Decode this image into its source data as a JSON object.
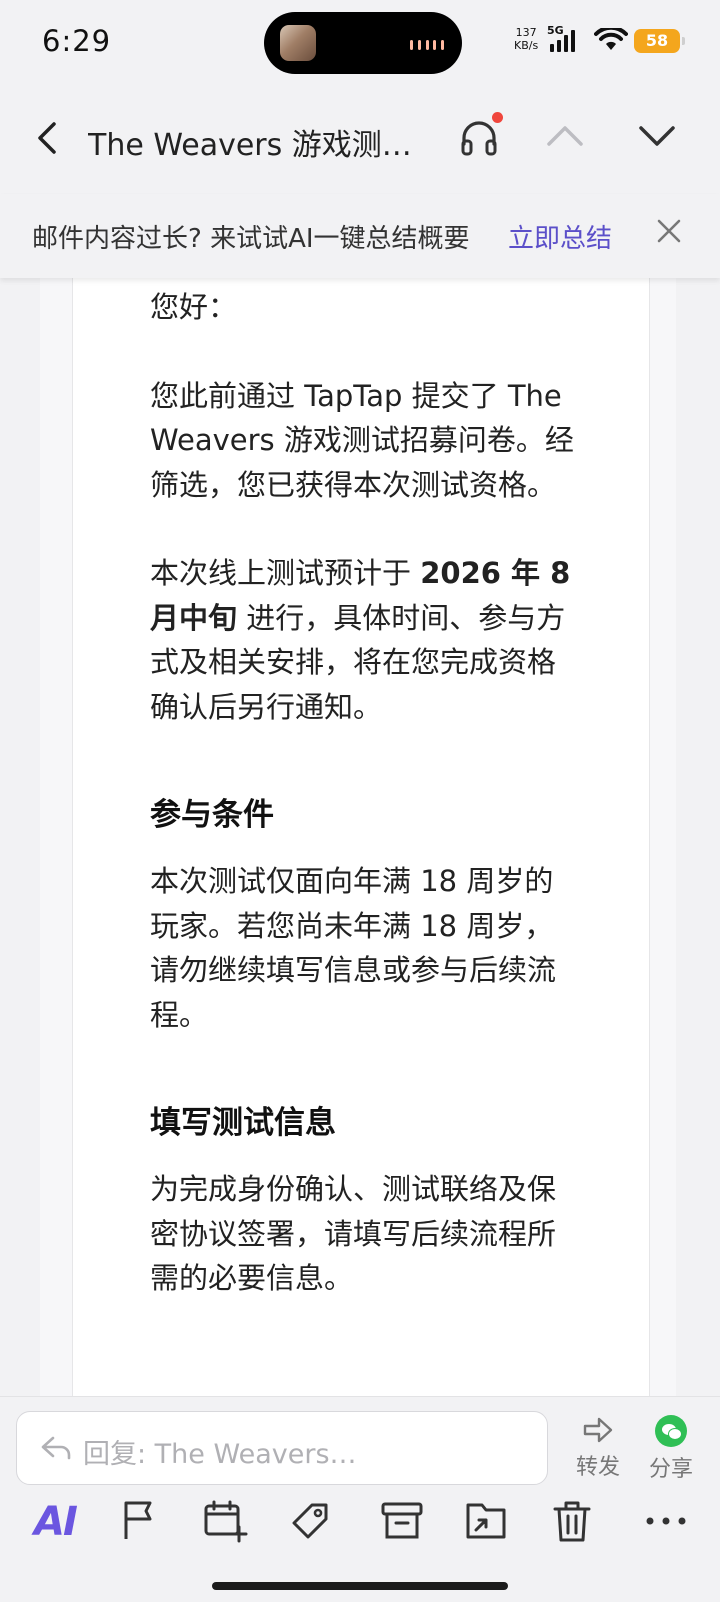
{
  "status_bar": {
    "time": "6:29",
    "net_speed_value": "137",
    "net_speed_unit": "KB/s",
    "network_type": "5G",
    "battery_level": "58",
    "battery_color": "#f4a61d"
  },
  "header": {
    "title": "The Weavers 游戏测…",
    "icons": [
      "back-icon",
      "headset-icon",
      "chevron-up-icon",
      "chevron-down-icon"
    ],
    "notification_dot_color": "#f0463c"
  },
  "banner": {
    "text": "邮件内容过长? 来试试AI一键总结概要",
    "link_label": "立即总结",
    "link_color": "#5b4fc9"
  },
  "mail": {
    "greeting": "您好：",
    "para1": "您此前通过 TapTap 提交了 The Weavers 游戏测试招募问卷。经筛选，您已获得本次测试资格。",
    "para2_prefix": "本次线上测试预计于 ",
    "para2_bold": "2026 年 8 月中旬",
    "para2_suffix": " 进行，具体时间、参与方式及相关安排，将在您完成资格确认后另行通知。",
    "section1_title": "参与条件",
    "section1_text": "本次测试仅面向年满 18 周岁的玩家。若您尚未年满 18 周岁，请勿继续填写信息或参与后续流程。",
    "section2_title": "填写测试信息",
    "section2_text": "为完成身份确认、测试联络及保密协议签署，请填写后续流程所需的必要信息。"
  },
  "bottom": {
    "reply_placeholder": "回复: The Weavers…",
    "forward_label": "转发",
    "share_label": "分享",
    "ai_label": "AI",
    "ai_color": "#6b56e0",
    "toolbar_icons": [
      "ai-icon",
      "flag-icon",
      "calendar-add-icon",
      "tag-icon",
      "archive-icon",
      "move-folder-icon",
      "trash-icon",
      "more-icon"
    ]
  }
}
